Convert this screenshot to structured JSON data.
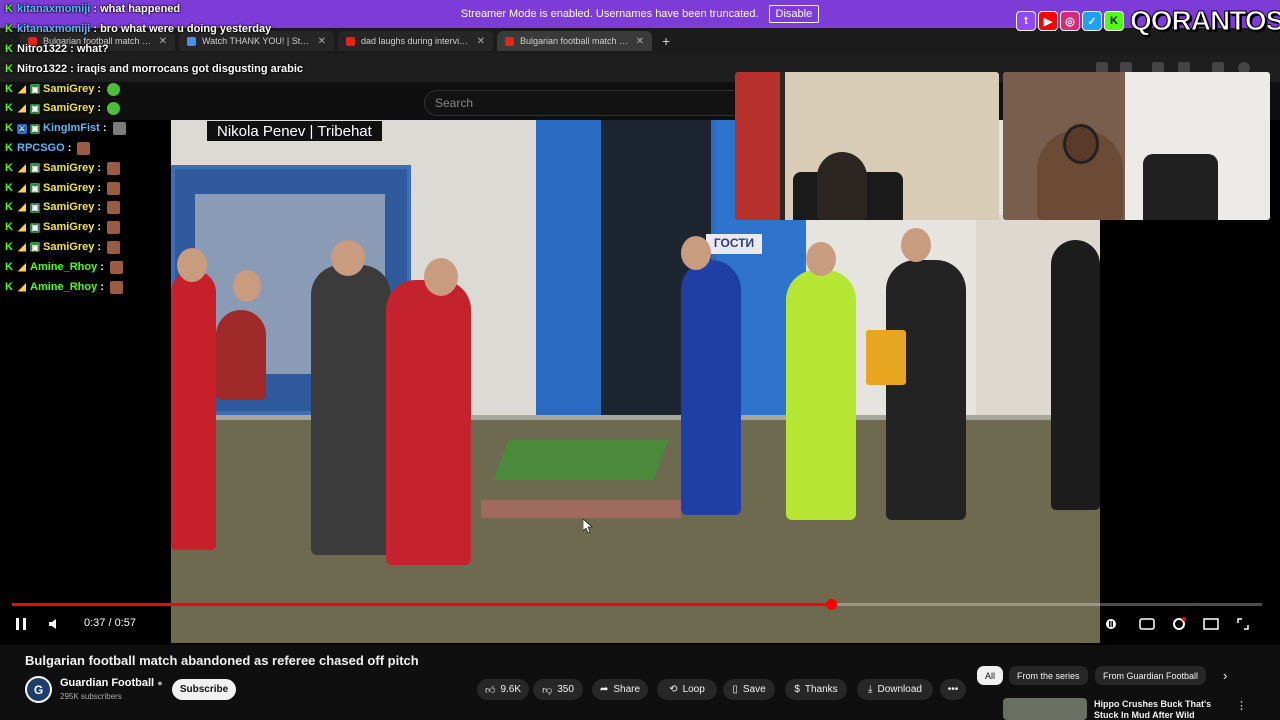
{
  "streamer_bar": {
    "message": "Streamer Mode is enabled. Usernames have been truncated.",
    "disable_label": "Disable"
  },
  "browser": {
    "tabs": [
      {
        "title": "Bulgarian football match aband...",
        "active": false
      },
      {
        "title": "Watch THANK YOU! | Streamin...",
        "active": false
      },
      {
        "title": "dad laughs during interview - Y...",
        "active": false
      },
      {
        "title": "Bulgarian football match ab...",
        "active": true
      }
    ],
    "new_tab": "+"
  },
  "youtube": {
    "search_placeholder": "Search"
  },
  "video": {
    "caption": "Nikola Penev | Tribehat",
    "sign_text": "ГОСТИ",
    "current_time": "0:37",
    "duration": "0:57",
    "time_display": "0:37 / 0:57",
    "progress": 0.655,
    "title": "Bulgarian football match abandoned as referee chased off pitch"
  },
  "channel": {
    "name": "Guardian Football",
    "avatar_letter": "G",
    "subscribers": "295K subscribers",
    "subscribe_label": "Subscribe"
  },
  "actions": {
    "likes": "9.6K",
    "dislikes": "350",
    "share": "Share",
    "loop": "Loop",
    "save": "Save",
    "thanks": "Thanks",
    "download": "Download",
    "more": "•••"
  },
  "chips": [
    "All",
    "From the series",
    "From Guardian Football"
  ],
  "recommendation": {
    "title": "Hippo Crushes Buck That's Stuck In Mud After Wild Rescue"
  },
  "brand": {
    "name": "QORANTOS",
    "k_letter": "K"
  },
  "chat": [
    {
      "user": "kitanaxmomiji",
      "color": "#5db7f5",
      "badges": [
        "k"
      ],
      "message": ": what happened",
      "emote": ""
    },
    {
      "user": "kitanaxmomiji",
      "color": "#5db7f5",
      "badges": [
        "k"
      ],
      "message": ": bro what were u doing yesterday",
      "emote": ""
    },
    {
      "user": "Nitro1322",
      "color": "#ffffff",
      "badges": [
        "k"
      ],
      "message": ": what?",
      "emote": ""
    },
    {
      "user": "Nitro1322",
      "color": "#ffffff",
      "badges": [
        "k"
      ],
      "message": ": iraqis and morrocans got disgusting arabic",
      "emote": ""
    },
    {
      "user": "SamiGrey",
      "color": "#f2e24a",
      "badges": [
        "k",
        "gold",
        "sub"
      ],
      "message": ":",
      "emote": "green"
    },
    {
      "user": "SamiGrey",
      "color": "#f2e24a",
      "badges": [
        "k",
        "gold",
        "sub"
      ],
      "message": ":",
      "emote": "green"
    },
    {
      "user": "KingImFist",
      "color": "#5db7f5",
      "badges": [
        "k",
        "mod",
        "sub"
      ],
      "message": ":",
      "emote": "gray"
    },
    {
      "user": "RPCSGO",
      "color": "#5db7f5",
      "badges": [
        "k"
      ],
      "message": ":",
      "emote": "red"
    },
    {
      "user": "SamiGrey",
      "color": "#f2e24a",
      "badges": [
        "k",
        "gold",
        "sub"
      ],
      "message": ":",
      "emote": "red"
    },
    {
      "user": "SamiGrey",
      "color": "#f2e24a",
      "badges": [
        "k",
        "gold",
        "sub"
      ],
      "message": ":",
      "emote": "red"
    },
    {
      "user": "SamiGrey",
      "color": "#f2e24a",
      "badges": [
        "k",
        "gold",
        "sub"
      ],
      "message": ":",
      "emote": "red"
    },
    {
      "user": "SamiGrey",
      "color": "#f2e24a",
      "badges": [
        "k",
        "gold",
        "sub"
      ],
      "message": ":",
      "emote": "red"
    },
    {
      "user": "SamiGrey",
      "color": "#f2e24a",
      "badges": [
        "k",
        "gold",
        "sub"
      ],
      "message": ":",
      "emote": "red"
    },
    {
      "user": "Amine_Rhoy",
      "color": "#53fc18",
      "badges": [
        "k",
        "gold"
      ],
      "message": ":",
      "emote": "red"
    },
    {
      "user": "Amine_Rhoy",
      "color": "#53fc18",
      "badges": [
        "k",
        "gold"
      ],
      "message": ":",
      "emote": "red"
    }
  ],
  "colors": {
    "streamer_bar": "#7d3bd8",
    "progress": "#ff0000",
    "background": "#0f0f0f"
  }
}
